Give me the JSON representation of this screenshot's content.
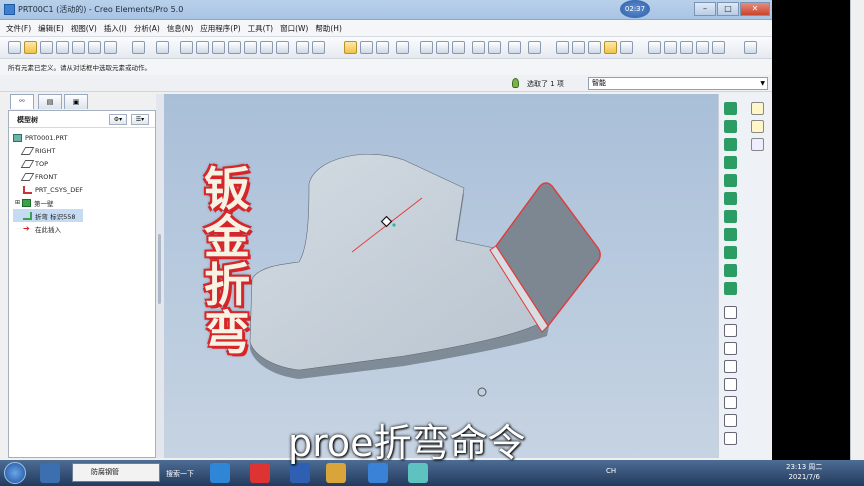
{
  "window": {
    "title": "PRT00C1 (活动的) - Creo Elements/Pro 5.0",
    "clock_badge": "02:37",
    "buttons": [
      "–",
      "□",
      "✕"
    ]
  },
  "menu": [
    "文件(F)",
    "编辑(E)",
    "视图(V)",
    "插入(I)",
    "分析(A)",
    "信息(N)",
    "应用程序(P)",
    "工具(T)",
    "窗口(W)",
    "帮助(H)"
  ],
  "message": "所有元素已定义。请从对话框中选取元素或动作。",
  "selection": {
    "count_text": "选取了 1 项",
    "filter_value": "智能"
  },
  "nav_tabs": [
    "model-tree-tab",
    "layer-tree-tab",
    "folder-tab"
  ],
  "model_tree": {
    "header": "模型树",
    "items": [
      {
        "label": "PRT0001.PRT",
        "icon": "part-icon"
      },
      {
        "label": "RIGHT",
        "icon": "datum-plane-icon"
      },
      {
        "label": "TOP",
        "icon": "datum-plane-icon"
      },
      {
        "label": "FRONT",
        "icon": "datum-plane-icon"
      },
      {
        "label": "PRT_CSYS_DEF",
        "icon": "csys-icon"
      },
      {
        "label": "第一壁",
        "icon": "wall-icon"
      },
      {
        "label": "折弯 标识558",
        "icon": "bend-icon"
      },
      {
        "label": "在此插入",
        "icon": "insert-arrow-icon"
      }
    ]
  },
  "overlay": {
    "title_chars": [
      "钣",
      "金",
      "折",
      "弯"
    ],
    "subtitle": "proe折弯命令"
  },
  "taskbar": {
    "search_text": "防腐钢管",
    "search_button": "搜索一下",
    "tray_lang": "CH",
    "time": "23:13 周二",
    "date": "2021/7/6"
  },
  "colors": {
    "viewport_top": "#a9bfd8",
    "part_face": "#c9d3dc",
    "flange_face": "#7c8791",
    "edge_highlight": "#e23a3a",
    "overlay_red": "#d6262a"
  }
}
